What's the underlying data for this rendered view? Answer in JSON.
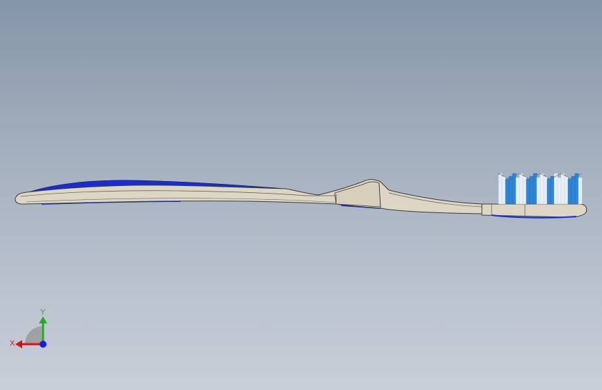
{
  "window": {
    "background_top": "#8595a8",
    "background_bottom": "#c9cfd9"
  },
  "model": {
    "body_color": "#ddd6c4",
    "edge_color": "#3a3a3a",
    "grip_color": "#1a2dd0",
    "bristle_blue": "#2f86d8",
    "bristle_white": "#e8eef6"
  },
  "triad": {
    "x_label": "X",
    "y_label": "Y",
    "x_color": "#d4141a",
    "y_color": "#1fae22",
    "z_color": "#1020e0"
  }
}
